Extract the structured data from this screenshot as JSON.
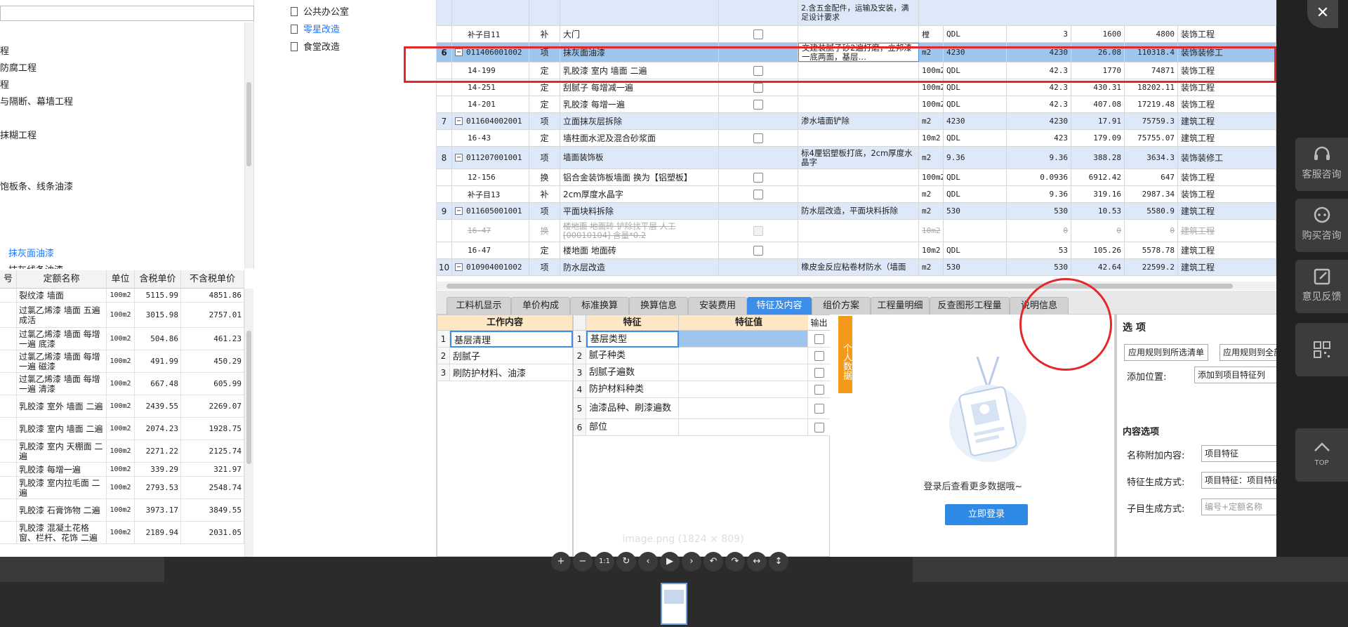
{
  "left_tree": {
    "items": [
      "程",
      "防腐工程",
      "程",
      "与隔断、幕墙工程",
      "抹糊工程",
      "饱板条、线条油漆",
      "抹灰面油漆",
      "抹灰线条油漆"
    ],
    "active_item": "抹灰面油漆"
  },
  "quota_table": {
    "headers": [
      "号",
      "定额名称",
      "单位",
      "含税单价",
      "不含税单价"
    ],
    "rows": [
      {
        "name": "裂纹漆 墙面",
        "unit": "100m2",
        "tax_price": "5115.99",
        "notax_price": "4851.86"
      },
      {
        "name": "过氯乙烯漆 墙面 五遍成活",
        "unit": "100m2",
        "tax_price": "3015.98",
        "notax_price": "2757.01"
      },
      {
        "name": "过氯乙烯漆 墙面 每增一遍 底漆",
        "unit": "100m2",
        "tax_price": "504.86",
        "notax_price": "461.23"
      },
      {
        "name": "过氯乙烯漆 墙面 每增一遍 磁漆",
        "unit": "100m2",
        "tax_price": "491.99",
        "notax_price": "450.29"
      },
      {
        "name": "过氯乙烯漆 墙面 每增一遍 清漆",
        "unit": "100m2",
        "tax_price": "667.48",
        "notax_price": "605.99"
      },
      {
        "name": "乳胶漆 室外 墙面 二遍",
        "unit": "100m2",
        "tax_price": "2439.55",
        "notax_price": "2269.07"
      },
      {
        "name": "乳胶漆 室内 墙面 二遍",
        "unit": "100m2",
        "tax_price": "2074.23",
        "notax_price": "1928.75"
      },
      {
        "name": "乳胶漆 室内 天棚面 二遍",
        "unit": "100m2",
        "tax_price": "2271.22",
        "notax_price": "2125.74"
      },
      {
        "name": "乳胶漆 每增一遍",
        "unit": "100m2",
        "tax_price": "339.29",
        "notax_price": "321.97"
      },
      {
        "name": "乳胶漆 室内拉毛面 二遍",
        "unit": "100m2",
        "tax_price": "2793.53",
        "notax_price": "2548.74"
      },
      {
        "name": "乳胶漆 石膏饰物 二遍",
        "unit": "100m2",
        "tax_price": "3973.17",
        "notax_price": "3849.55"
      },
      {
        "name": "乳胶漆 混凝土花格窗、栏杆、花饰 二遍",
        "unit": "100m2",
        "tax_price": "2189.94",
        "notax_price": "2031.05"
      }
    ]
  },
  "mid_tree": {
    "items": [
      "公共办公室",
      "零星改造",
      "食堂改造"
    ],
    "active_index": 1
  },
  "grid": {
    "top_partial_text": "2.含五金配件，运输及安装，满足设计要求",
    "rows": [
      {
        "seq": "",
        "code": "补子目11",
        "type": "补",
        "name": "大门",
        "feature": "",
        "unit": "樘",
        "expr": "QDL",
        "qty": "3",
        "price": "1600",
        "total": "4800",
        "prof": "装饰工程",
        "kind": "sub"
      },
      {
        "seq": "6",
        "code": "011406001002",
        "type": "项",
        "name": "抹灰面油漆",
        "feature": "交建装腻子砂2遍打磨，立邦漆一底两面，基层…",
        "unit": "m2",
        "expr": "4230",
        "qty": "4230",
        "price": "26.08",
        "total": "110318.4",
        "prof": "装饰装修工",
        "kind": "sel"
      },
      {
        "seq": "",
        "code": "14-199",
        "type": "定",
        "name": "乳胶漆 室内 墙面 二遍",
        "feature": "",
        "unit": "100m2",
        "expr": "QDL",
        "qty": "42.3",
        "price": "1770",
        "total": "74871",
        "prof": "装饰工程",
        "kind": "sub"
      },
      {
        "seq": "",
        "code": "14-251",
        "type": "定",
        "name": "刮腻子 每增减一遍",
        "feature": "",
        "unit": "100m2",
        "expr": "QDL",
        "qty": "42.3",
        "price": "430.31",
        "total": "18202.11",
        "prof": "装饰工程",
        "kind": "sub"
      },
      {
        "seq": "",
        "code": "14-201",
        "type": "定",
        "name": "乳胶漆 每增一遍",
        "feature": "",
        "unit": "100m2",
        "expr": "QDL",
        "qty": "42.3",
        "price": "407.08",
        "total": "17219.48",
        "prof": "装饰工程",
        "kind": "sub"
      },
      {
        "seq": "7",
        "code": "011604002001",
        "type": "项",
        "name": "立面抹灰层拆除",
        "feature": "渗水墙面铲除",
        "unit": "m2",
        "expr": "4230",
        "qty": "4230",
        "price": "17.91",
        "total": "75759.3",
        "prof": "建筑工程",
        "kind": "item"
      },
      {
        "seq": "",
        "code": "16-43",
        "type": "定",
        "name": "墙柱面水泥及混合砂浆面",
        "feature": "",
        "unit": "10m2",
        "expr": "QDL",
        "qty": "423",
        "price": "179.09",
        "total": "75755.07",
        "prof": "建筑工程",
        "kind": "sub"
      },
      {
        "seq": "8",
        "code": "011207001001",
        "type": "项",
        "name": "墙面装饰板",
        "feature": "标4厘铝塑板打底，2cm厚度水晶字",
        "unit": "m2",
        "expr": "9.36",
        "qty": "9.36",
        "price": "388.28",
        "total": "3634.3",
        "prof": "装饰装修工",
        "kind": "item2"
      },
      {
        "seq": "",
        "code": "12-156",
        "type": "换",
        "name": "铝合金装饰板墙面  换为【铝塑板】",
        "feature": "",
        "unit": "100m2",
        "expr": "QDL",
        "qty": "0.0936",
        "price": "6912.42",
        "total": "647",
        "prof": "装饰工程",
        "kind": "sub"
      },
      {
        "seq": "",
        "code": "补子目13",
        "type": "补",
        "name": "2cm厚度水晶字",
        "feature": "",
        "unit": "m2",
        "expr": "QDL",
        "qty": "9.36",
        "price": "319.16",
        "total": "2987.34",
        "prof": "装饰工程",
        "kind": "sub"
      },
      {
        "seq": "9",
        "code": "011605001001",
        "type": "项",
        "name": "平面块料拆除",
        "feature": "防水层改造，平面块料拆除",
        "unit": "m2",
        "expr": "530",
        "qty": "530",
        "price": "10.53",
        "total": "5580.9",
        "prof": "建筑工程",
        "kind": "item"
      },
      {
        "seq": "",
        "code": "16-47",
        "type": "换",
        "name": "楼地面 地面砖  铲除找平层 人工[00010104] 含量*0.2",
        "feature": "",
        "unit": "10m2",
        "expr": "",
        "qty": "0",
        "price": "0",
        "total": "0",
        "prof": "建筑工程",
        "kind": "strike"
      },
      {
        "seq": "",
        "code": "16-47",
        "type": "定",
        "name": "楼地面 地面砖",
        "feature": "",
        "unit": "10m2",
        "expr": "QDL",
        "qty": "53",
        "price": "105.26",
        "total": "5578.78",
        "prof": "建筑工程",
        "kind": "sub"
      },
      {
        "seq": "10",
        "code": "010904001002",
        "type": "项",
        "name": "防水层改造",
        "feature": "橡皮金反应粘卷材防水（墙面",
        "unit": "m2",
        "expr": "530",
        "qty": "530",
        "price": "42.64",
        "total": "22599.2",
        "prof": "建筑工程",
        "kind": "item"
      }
    ]
  },
  "tabs": [
    "工料机显示",
    "单价构成",
    "标准换算",
    "换算信息",
    "安装费用",
    "特征及内容",
    "组价方案",
    "工程量明细",
    "反查图形工程量",
    "说明信息"
  ],
  "active_tab": "特征及内容",
  "work_content": {
    "header": "工作内容",
    "rows": [
      "基层清理",
      "刮腻子",
      "刷防护材料、油漆"
    ]
  },
  "features": {
    "headers": [
      "特征",
      "特征值",
      "输出"
    ],
    "rows": [
      "基层类型",
      "腻子种类",
      "刮腻子遍数",
      "防护材料种类",
      "油漆品种、刷漆遍数",
      "部位"
    ]
  },
  "personal_tab": "个人数据",
  "login": {
    "text": "登录后查看更多数据哦~",
    "button": "立即登录"
  },
  "options": {
    "title": "选 项",
    "btn1": "应用规则到所选清单",
    "btn2": "应用规则到全部",
    "add_pos_label": "添加位置:",
    "add_pos_value": "添加到项目特征列",
    "content_title": "内容选项",
    "name_append_label": "名称附加内容:",
    "name_append_value": "项目特征",
    "feature_mode_label": "特征生成方式:",
    "feature_mode_value": "项目特征：项目特征值",
    "sub_mode_label": "子目生成方式:",
    "sub_mode_value": "编号+定额名称"
  },
  "service": [
    "客服咨询",
    "购买咨询",
    "意见反馈",
    "",
    "TOP"
  ],
  "viewer": {
    "caption": "image.png (1824 × 809)",
    "close": "✕",
    "buttons": [
      "+",
      "−",
      "1:1",
      "↻",
      "‹",
      "▶",
      "›",
      "↶",
      "↷",
      "↔",
      "↕"
    ]
  },
  "colors": {
    "accent": "#3d8ee8",
    "selected_row": "#9ec5ee",
    "alt_row": "#dde9f8",
    "annotation": "#e5262a",
    "login_btn": "#2f8ae5"
  }
}
